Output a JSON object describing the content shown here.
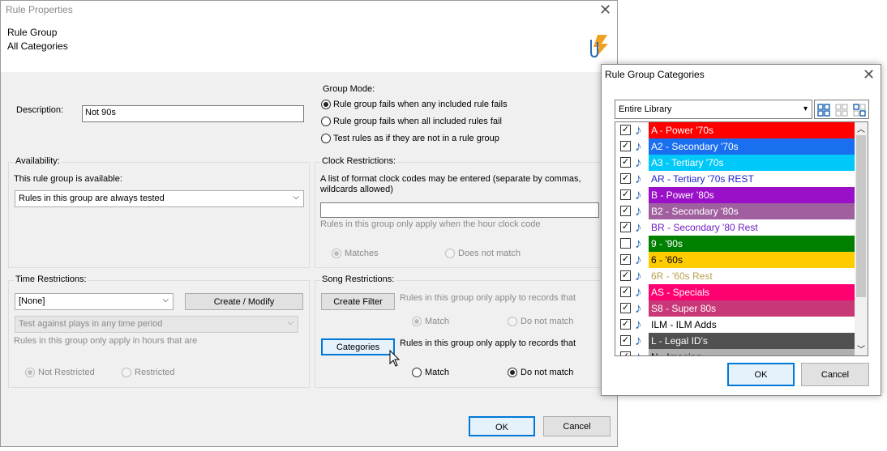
{
  "main": {
    "title": "Rule Properties",
    "header_line1": "Rule Group",
    "header_line2": "All Categories",
    "description_label": "Description:",
    "description_value": "Not 90s",
    "availability": {
      "legend": "Availability:",
      "label": "This rule group is available:",
      "selected": "Rules in this group are always tested"
    },
    "group_mode": {
      "legend": "Group Mode:",
      "options": [
        "Rule group fails when any included rule fails",
        "Rule group fails when all included rules fail",
        "Test rules as if they are not in a rule group"
      ],
      "selected_index": 0
    },
    "clock": {
      "legend": "Clock Restrictions:",
      "desc": "A list of format clock codes may be entered (separate by commas, wildcards allowed)",
      "desc_line1": "A list of format clock codes may be entered (separate by commas,",
      "desc_line2": "wildcards allowed)",
      "value": "",
      "note": "Rules in this group only apply when the hour clock code",
      "matches": "Matches",
      "not_match": "Does not match"
    },
    "time": {
      "legend": "Time Restrictions:",
      "selected": "[None]",
      "create_button": "Create / Modify",
      "period_selected": "Test against plays in any time period",
      "note": "Rules in this group only apply in hours that are",
      "not_restricted": "Not Restricted",
      "restricted": "Restricted"
    },
    "song": {
      "legend": "Song Restrictions:",
      "filter_button": "Create Filter",
      "filter_note": "Rules in this group only apply to records that",
      "match": "Match",
      "not_match": "Do not match",
      "categories_button": "Categories",
      "cat_note": "Rules in this group only apply to records that",
      "cat_match": "Match",
      "cat_not_match": "Do not match"
    },
    "ok": "OK",
    "cancel": "Cancel"
  },
  "categories_dialog": {
    "title": "Rule Group Categories",
    "library": "Entire Library",
    "items": [
      {
        "label": "A - Power '70s",
        "checked": true,
        "bg": "#ff0000",
        "fg": "#ffffff"
      },
      {
        "label": "A2 - Secondary '70s",
        "checked": true,
        "bg": "#1a6ff0",
        "fg": "#ffffff"
      },
      {
        "label": "A3 - Tertiary '70s",
        "checked": true,
        "bg": "#00c8f8",
        "fg": "#ffffff"
      },
      {
        "label": "AR - Tertiary '70s REST",
        "checked": true,
        "bg": "#ffffff",
        "fg": "#2020d0"
      },
      {
        "label": "B - Power '80s",
        "checked": true,
        "bg": "#9a10c8",
        "fg": "#ffffff"
      },
      {
        "label": "B2 - Secondary '80s",
        "checked": true,
        "bg": "#a060a0",
        "fg": "#ffffff"
      },
      {
        "label": "BR - Secondary '80 Rest",
        "checked": true,
        "bg": "#ffffff",
        "fg": "#7020c0"
      },
      {
        "label": "9 - '90s",
        "checked": false,
        "bg": "#008000",
        "fg": "#ffffff"
      },
      {
        "label": "6 - '60s",
        "checked": true,
        "bg": "#ffcc00",
        "fg": "#000000"
      },
      {
        "label": "6R - '60s Rest",
        "checked": true,
        "bg": "#ffffff",
        "fg": "#b8a050"
      },
      {
        "label": "AS - Specials",
        "checked": true,
        "bg": "#ff0070",
        "fg": "#ffffff"
      },
      {
        "label": "S8 - Super 80s",
        "checked": true,
        "bg": "#c83878",
        "fg": "#ffffff"
      },
      {
        "label": "ILM - ILM Adds",
        "checked": true,
        "bg": "#ffffff",
        "fg": "#000000"
      },
      {
        "label": "L - Legal ID's",
        "checked": true,
        "bg": "#505050",
        "fg": "#ffffff"
      },
      {
        "label": "N - Imaging",
        "checked": true,
        "bg": "#b0b0b0",
        "fg": "#000000"
      }
    ],
    "ok": "OK",
    "cancel": "Cancel"
  }
}
